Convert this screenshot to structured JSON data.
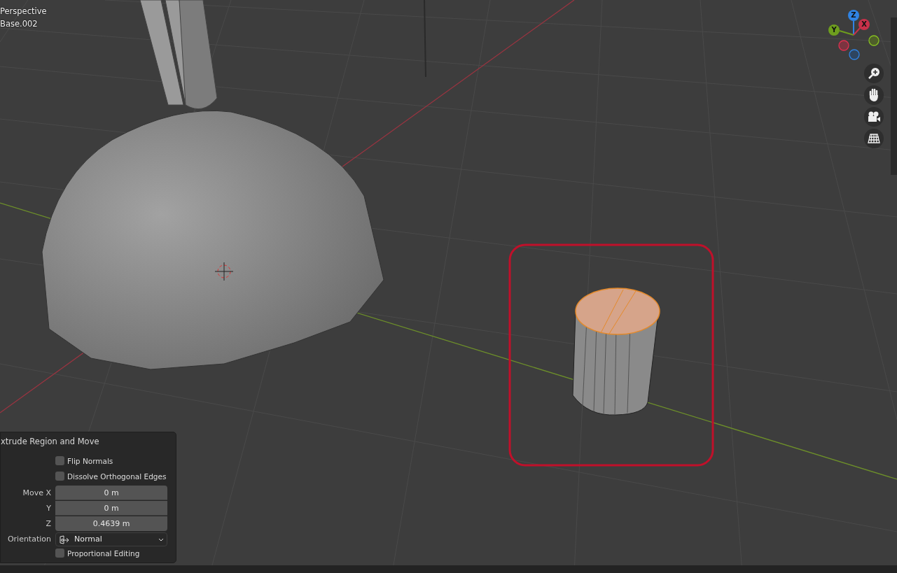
{
  "viewport": {
    "view_name": "Perspective",
    "object_name": "Base.002"
  },
  "gizmo": {
    "axes": [
      {
        "label": "Z",
        "color": "#2f83e3"
      },
      {
        "label": "X",
        "color": "#c8314a"
      },
      {
        "label": "Y",
        "color": "#6e9e1e"
      }
    ]
  },
  "operator_panel": {
    "title": "xtrude Region and Move",
    "rows": [
      {
        "kind": "checkbox",
        "label": "Flip Normals",
        "checked": false
      },
      {
        "kind": "checkbox",
        "label": "Dissolve Orthogonal Edges",
        "checked": false
      },
      {
        "kind": "number",
        "label": "Move X",
        "value": "0 m"
      },
      {
        "kind": "number",
        "label": "Y",
        "value": "0 m"
      },
      {
        "kind": "number",
        "label": "Z",
        "value": "0.4639 m"
      },
      {
        "kind": "dropdown",
        "label": "Orientation",
        "value": "Normal"
      },
      {
        "kind": "checkbox",
        "label": "Proportional Editing",
        "checked": false
      }
    ]
  }
}
